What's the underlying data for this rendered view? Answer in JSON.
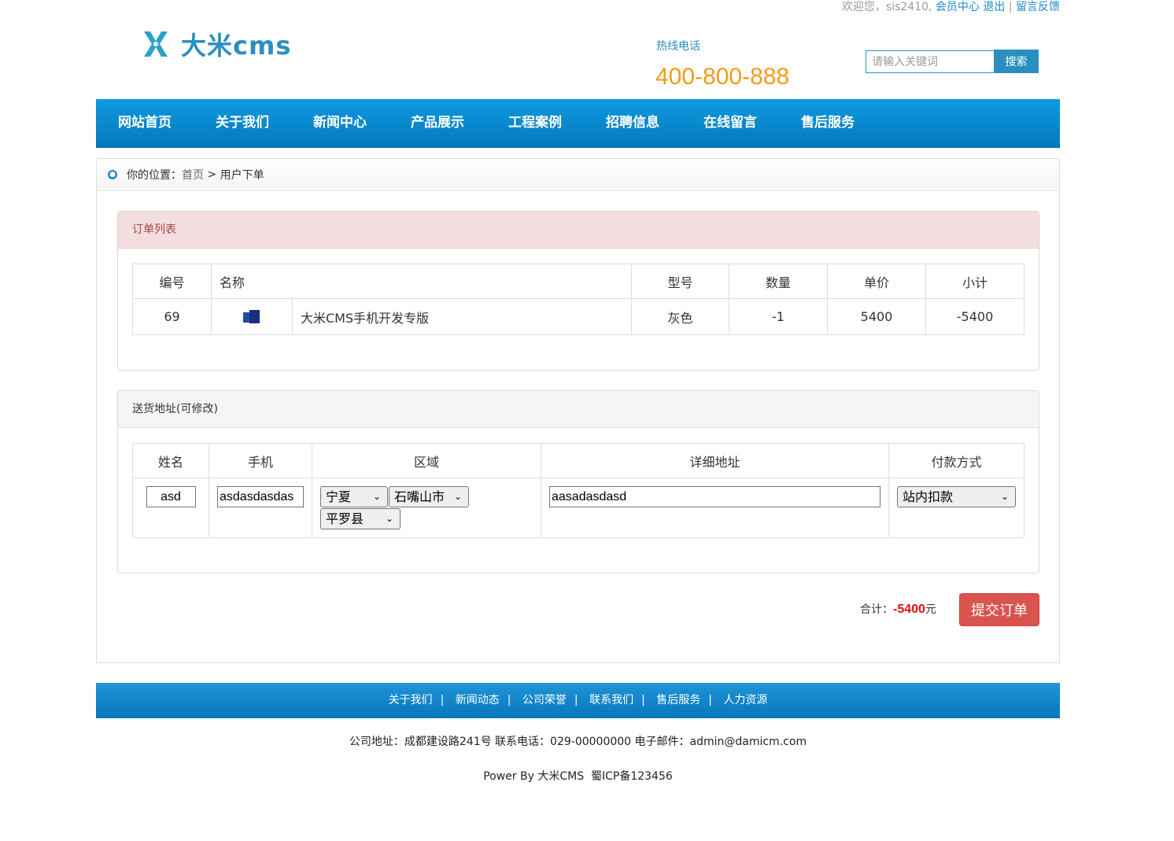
{
  "topbar": {
    "welcome": "欢迎您，sis2410,",
    "member_center": "会员中心",
    "logout": "退出",
    "separator": "|",
    "feedback": "留言反馈"
  },
  "header": {
    "logo_text": "大米cms",
    "hotline_label": "热线电话",
    "hotline_number": "400-800-888",
    "search_placeholder": "请输入关键词",
    "search_button": "搜索"
  },
  "nav": {
    "items": [
      "网站首页",
      "关于我们",
      "新闻中心",
      "产品展示",
      "工程案例",
      "招聘信息",
      "在线留言",
      "售后服务"
    ]
  },
  "breadcrumb": {
    "label": "你的位置：",
    "home": "首页",
    "separator": " > ",
    "current": "用户下单"
  },
  "order_panel": {
    "title": "订单列表",
    "headers": {
      "id": "编号",
      "name": "名称",
      "model": "型号",
      "qty": "数量",
      "price": "单价",
      "subtotal": "小计"
    },
    "rows": [
      {
        "id": "69",
        "name": "大米CMS手机开发专版",
        "model": "灰色",
        "qty": "-1",
        "price": "5400",
        "subtotal": "-5400"
      }
    ]
  },
  "address_panel": {
    "title": "送货地址(可修改)",
    "headers": {
      "name": "姓名",
      "phone": "手机",
      "region": "区域",
      "detail": "详细地址",
      "payment": "付款方式"
    },
    "values": {
      "name": "asd",
      "phone": "asdasdasdas",
      "province": "宁夏",
      "city": "石嘴山市",
      "county": "平罗县",
      "detail": "aasadasdasd",
      "payment": "站内扣款"
    }
  },
  "summary": {
    "total_label": "合计：",
    "total_amount": "-5400",
    "currency": "元",
    "submit": "提交订单"
  },
  "footer": {
    "links": [
      "关于我们",
      "新闻动态",
      "公司荣誉",
      "联系我们",
      "售后服务",
      "人力资源"
    ],
    "info": "公司地址：成都建设路241号 联系电话：029-00000000 电子邮件：admin@damicm.com",
    "power": "Power By 大米CMS  蜀ICP备123456"
  }
}
